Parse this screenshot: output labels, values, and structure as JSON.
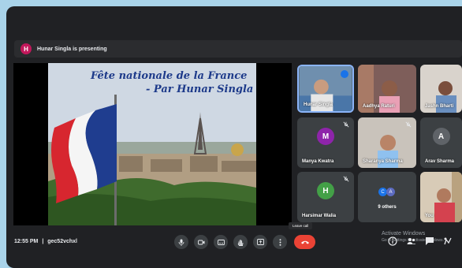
{
  "presenting": {
    "avatar_letter": "H",
    "text": "Hunar Singla is presenting"
  },
  "slide": {
    "title_line1": "Fête nationale de la France",
    "title_line2": "- Par Hunar Singla"
  },
  "participants": [
    {
      "name": "Hunar Singla",
      "video": true
    },
    {
      "name": "Aadhya Raturi",
      "video": true
    },
    {
      "name": "Jashn Bharti",
      "video": true
    },
    {
      "name": "Manya Kwatra",
      "avatar_letter": "M",
      "color": "#8e24aa"
    },
    {
      "name": "Sharanya Sharma",
      "video": true
    },
    {
      "name": "Arav Sharma",
      "avatar_letter": "A",
      "color": "#5f6368"
    },
    {
      "name": "Harsimar Walia",
      "avatar_letter": "H",
      "color": "#43a047"
    },
    {
      "name": "9 others",
      "avatar_letters": [
        "C",
        "A"
      ]
    },
    {
      "name": "You",
      "video": true
    }
  ],
  "footer": {
    "time": "12:55 PM",
    "separator": "|",
    "meeting_code": "gec52vchxl",
    "leave_tooltip": "Leave call"
  },
  "watermark": {
    "line1": "Activate Windows",
    "line2": "Go to Settings to activate Windows."
  },
  "icons": [
    "mic-icon",
    "camera-icon",
    "captions-icon",
    "hand-icon",
    "present-icon",
    "more-icon",
    "phone-end-icon",
    "info-icon",
    "people-icon",
    "chat-icon",
    "activities-icon"
  ]
}
